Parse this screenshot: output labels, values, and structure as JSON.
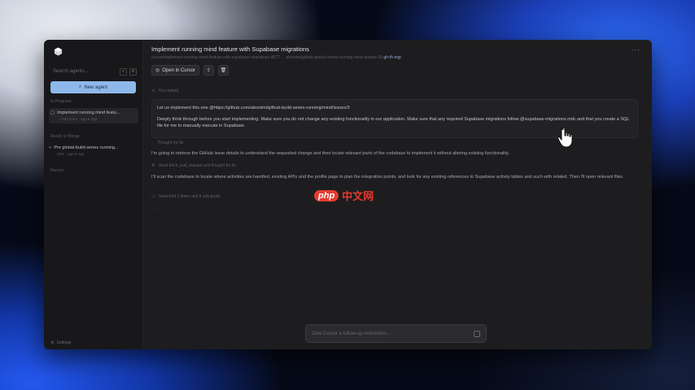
{
  "sidebar": {
    "search_placeholder": "Search agents...",
    "new_agent_label": "New agent",
    "in_progress_label": "In Progress",
    "agents_in_progress": [
      {
        "title": "Implement running mind featu...",
        "meta": "+ Add more · ago 8 mgt"
      }
    ],
    "ready_label": "Ready to Merge",
    "agents_ready": [
      {
        "title": "Pre global-build-series running...",
        "meta": "20% · ago 8 mgt"
      }
    ],
    "recent_label": "Recent",
    "settings_label": "Settings"
  },
  "header": {
    "title": "Implement running mind feature with Supabase migrations",
    "subtitle": "cursor/implement-running-mind-feature-with-supabase-migrations-d677 → alexnimi/github-global-series-running-mind-update-39",
    "subtitle_link": "gh-th-mgt",
    "more_icon": "ellipsis-icon"
  },
  "toolbar": {
    "open_in_cursor_label": "Open in Cursor"
  },
  "conversation": {
    "user_label": "You replied",
    "prompt_line1": "Let us implement this one @https://github.com/alexnimi/github-build-series-running/mind/issues/3",
    "prompt_line2": "Deeply think through before you start implementing. Make sure you do not change any existing functionality in our application. Make sure that any required Supabase migrations follow @supabase-migrations.mdc and that you create a SQL file for me to manually execute in Supabase.",
    "thought_label": "Thought for 6s",
    "response1": "I'm going to retrieve the GitHub issue details to understand the requested change and then locate relevant parts of the codebase to implement it without altering existing functionality.",
    "tool_label": "Used fetch_pull_request and thought for 6s",
    "response2": "I'll scan the codebase to locate where activities are handled, existing APIs and the profile page to plan the integration points, and look for any existing references to Supabase activity tables and such with related. Then I'll open relevant files.",
    "searched_label": "Searched 1 times and 8 sub-goals",
    "pending": "..."
  },
  "followup": {
    "placeholder": "Give Cursor a follow-up instruction..."
  },
  "watermark": {
    "logo": "php",
    "text": "中文网"
  }
}
